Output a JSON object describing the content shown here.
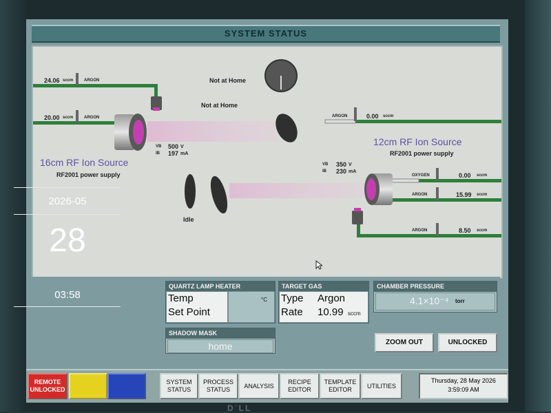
{
  "window": {
    "title": "SYSTEM STATUS"
  },
  "diagram": {
    "mfc": [
      {
        "value": "24.06",
        "unit": "sccm",
        "gas": "ARGON"
      },
      {
        "value": "20.00",
        "unit": "sccm",
        "gas": "ARGON"
      },
      {
        "value": "0.00",
        "unit": "sccm",
        "gas": "ARGON"
      },
      {
        "value": "0.00",
        "unit": "sccm",
        "gas": "OXYGEN"
      },
      {
        "value": "15.99",
        "unit": "sccm",
        "gas": "ARGON"
      },
      {
        "value": "8.50",
        "unit": "sccm",
        "gas": "ARGON"
      }
    ],
    "shutter_status_1": "Not at Home",
    "shutter_status_2": "Not at Home",
    "idle_label": "Idle",
    "source16": {
      "title": "16cm RF Ion Source",
      "subtitle": "RF2001 power supply",
      "vb_label": "VB",
      "vb_value": "500",
      "vb_unit": "V",
      "ib_label": "IB",
      "ib_value": "197",
      "ib_unit": "mA"
    },
    "source12": {
      "title": "12cm RF Ion Source",
      "subtitle": "RF2001 power supply",
      "vb_label": "VB",
      "vb_value": "350",
      "vb_unit": "V",
      "ib_label": "IB",
      "ib_value": "230",
      "ib_unit": "mA"
    }
  },
  "quartz": {
    "header": "QUARTZ LAMP HEATER",
    "temp_label": "Temp",
    "setpoint_label": "Set Point",
    "temp_unit": "°C"
  },
  "target_gas": {
    "header": "TARGET GAS",
    "type_label": "Type",
    "type_value": "Argon",
    "rate_label": "Rate",
    "rate_value": "10.99",
    "rate_unit": "sccm"
  },
  "chamber": {
    "header": "CHAMBER PRESSURE",
    "value": "4.1×10⁻⁴",
    "unit": "torr"
  },
  "shadow_mask": {
    "header": "SHADOW MASK",
    "value": "home"
  },
  "buttons": {
    "zoom_out": "ZOOM OUT",
    "unlocked": "UNLOCKED"
  },
  "toolbar": {
    "remote": "REMOTE UNLOCKED",
    "system_status": "SYSTEM STATUS",
    "process_status": "PROCESS STATUS",
    "analysis": "ANALYSIS",
    "recipe_editor": "RECIPE EDITOR",
    "template_editor": "TEMPLATE EDITOR",
    "utilities": "UTILITIES",
    "date": "Thursday, 28 May 2026",
    "time": "3:59:09 AM"
  },
  "overlay": {
    "year_month": "2026-05",
    "day": "28",
    "time": "03:58"
  },
  "colors": {
    "pipe": "#2f7f3c",
    "accent_purple": "#5a52a6",
    "remote_red": "#d42a2a",
    "yellow": "#e5d21e",
    "blue": "#2545b8"
  }
}
